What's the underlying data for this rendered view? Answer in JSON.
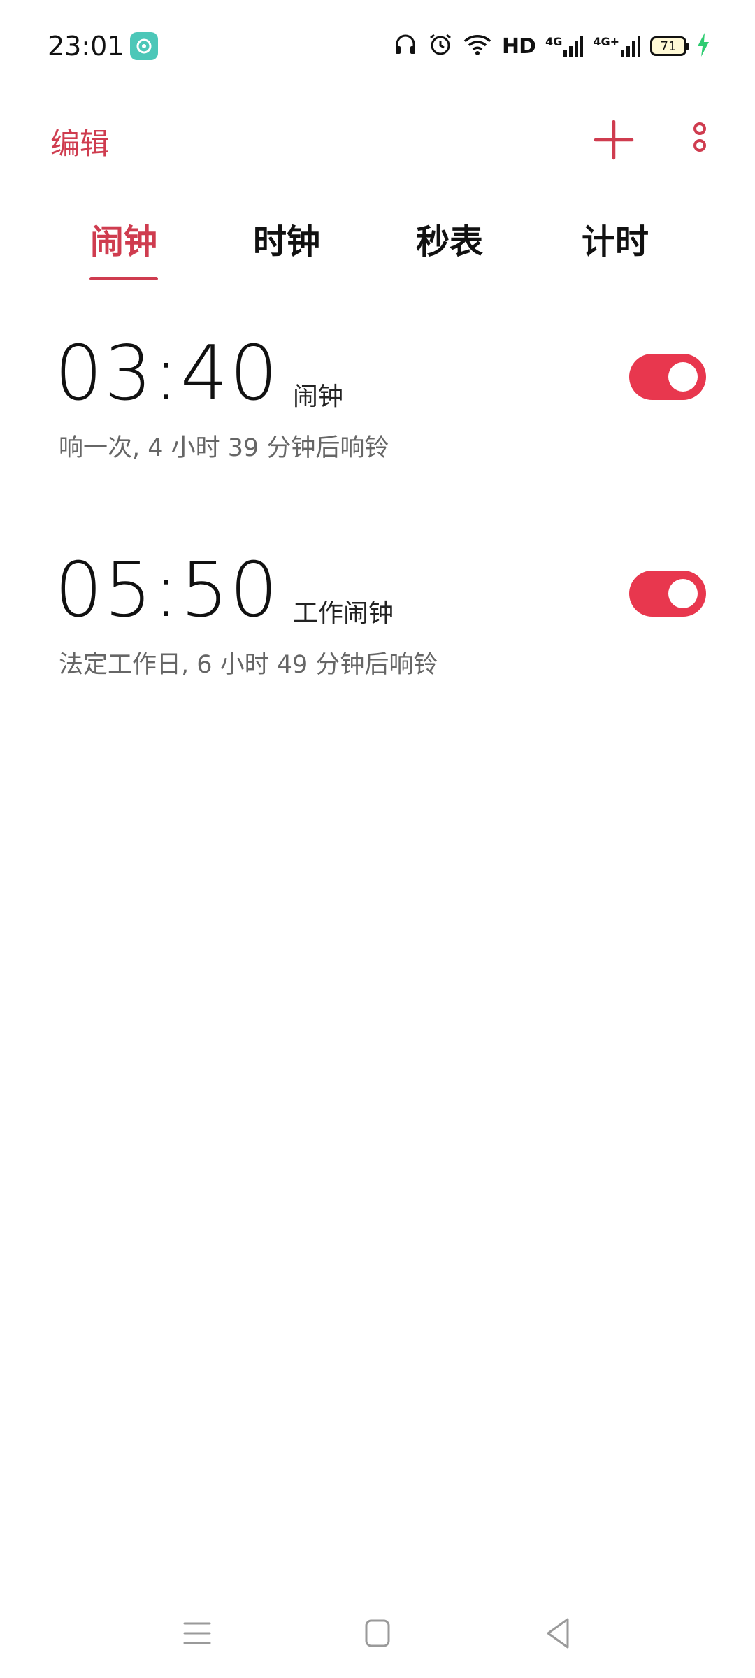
{
  "status_bar": {
    "time": "23:01",
    "hd_label": "HD",
    "network_1": "4G",
    "network_2": "4G+",
    "battery": "71"
  },
  "toolbar": {
    "edit_label": "编辑"
  },
  "tabs": [
    {
      "label": "闹钟",
      "active": true
    },
    {
      "label": "时钟",
      "active": false
    },
    {
      "label": "秒表",
      "active": false
    },
    {
      "label": "计时",
      "active": false
    }
  ],
  "alarms": [
    {
      "time": "03:40",
      "label": "闹钟",
      "subtitle": "响一次, 4 小时 39 分钟后响铃",
      "enabled": true
    },
    {
      "time": "05:50",
      "label": "工作闹钟",
      "subtitle": "法定工作日, 6 小时 49 分钟后响铃",
      "enabled": true
    }
  ],
  "colors": {
    "accent": "#cf3c4f",
    "toggle_on": "#e8374e",
    "charging": "#2ecc71"
  }
}
